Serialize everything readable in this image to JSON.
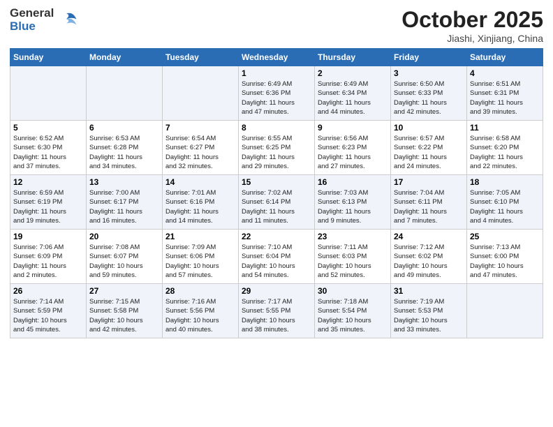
{
  "header": {
    "logo_general": "General",
    "logo_blue": "Blue",
    "month_title": "October 2025",
    "location": "Jiashi, Xinjiang, China"
  },
  "weekdays": [
    "Sunday",
    "Monday",
    "Tuesday",
    "Wednesday",
    "Thursday",
    "Friday",
    "Saturday"
  ],
  "rows": [
    [
      {
        "day": "",
        "info": ""
      },
      {
        "day": "",
        "info": ""
      },
      {
        "day": "",
        "info": ""
      },
      {
        "day": "1",
        "info": "Sunrise: 6:49 AM\nSunset: 6:36 PM\nDaylight: 11 hours\nand 47 minutes."
      },
      {
        "day": "2",
        "info": "Sunrise: 6:49 AM\nSunset: 6:34 PM\nDaylight: 11 hours\nand 44 minutes."
      },
      {
        "day": "3",
        "info": "Sunrise: 6:50 AM\nSunset: 6:33 PM\nDaylight: 11 hours\nand 42 minutes."
      },
      {
        "day": "4",
        "info": "Sunrise: 6:51 AM\nSunset: 6:31 PM\nDaylight: 11 hours\nand 39 minutes."
      }
    ],
    [
      {
        "day": "5",
        "info": "Sunrise: 6:52 AM\nSunset: 6:30 PM\nDaylight: 11 hours\nand 37 minutes."
      },
      {
        "day": "6",
        "info": "Sunrise: 6:53 AM\nSunset: 6:28 PM\nDaylight: 11 hours\nand 34 minutes."
      },
      {
        "day": "7",
        "info": "Sunrise: 6:54 AM\nSunset: 6:27 PM\nDaylight: 11 hours\nand 32 minutes."
      },
      {
        "day": "8",
        "info": "Sunrise: 6:55 AM\nSunset: 6:25 PM\nDaylight: 11 hours\nand 29 minutes."
      },
      {
        "day": "9",
        "info": "Sunrise: 6:56 AM\nSunset: 6:23 PM\nDaylight: 11 hours\nand 27 minutes."
      },
      {
        "day": "10",
        "info": "Sunrise: 6:57 AM\nSunset: 6:22 PM\nDaylight: 11 hours\nand 24 minutes."
      },
      {
        "day": "11",
        "info": "Sunrise: 6:58 AM\nSunset: 6:20 PM\nDaylight: 11 hours\nand 22 minutes."
      }
    ],
    [
      {
        "day": "12",
        "info": "Sunrise: 6:59 AM\nSunset: 6:19 PM\nDaylight: 11 hours\nand 19 minutes."
      },
      {
        "day": "13",
        "info": "Sunrise: 7:00 AM\nSunset: 6:17 PM\nDaylight: 11 hours\nand 16 minutes."
      },
      {
        "day": "14",
        "info": "Sunrise: 7:01 AM\nSunset: 6:16 PM\nDaylight: 11 hours\nand 14 minutes."
      },
      {
        "day": "15",
        "info": "Sunrise: 7:02 AM\nSunset: 6:14 PM\nDaylight: 11 hours\nand 11 minutes."
      },
      {
        "day": "16",
        "info": "Sunrise: 7:03 AM\nSunset: 6:13 PM\nDaylight: 11 hours\nand 9 minutes."
      },
      {
        "day": "17",
        "info": "Sunrise: 7:04 AM\nSunset: 6:11 PM\nDaylight: 11 hours\nand 7 minutes."
      },
      {
        "day": "18",
        "info": "Sunrise: 7:05 AM\nSunset: 6:10 PM\nDaylight: 11 hours\nand 4 minutes."
      }
    ],
    [
      {
        "day": "19",
        "info": "Sunrise: 7:06 AM\nSunset: 6:09 PM\nDaylight: 11 hours\nand 2 minutes."
      },
      {
        "day": "20",
        "info": "Sunrise: 7:08 AM\nSunset: 6:07 PM\nDaylight: 10 hours\nand 59 minutes."
      },
      {
        "day": "21",
        "info": "Sunrise: 7:09 AM\nSunset: 6:06 PM\nDaylight: 10 hours\nand 57 minutes."
      },
      {
        "day": "22",
        "info": "Sunrise: 7:10 AM\nSunset: 6:04 PM\nDaylight: 10 hours\nand 54 minutes."
      },
      {
        "day": "23",
        "info": "Sunrise: 7:11 AM\nSunset: 6:03 PM\nDaylight: 10 hours\nand 52 minutes."
      },
      {
        "day": "24",
        "info": "Sunrise: 7:12 AM\nSunset: 6:02 PM\nDaylight: 10 hours\nand 49 minutes."
      },
      {
        "day": "25",
        "info": "Sunrise: 7:13 AM\nSunset: 6:00 PM\nDaylight: 10 hours\nand 47 minutes."
      }
    ],
    [
      {
        "day": "26",
        "info": "Sunrise: 7:14 AM\nSunset: 5:59 PM\nDaylight: 10 hours\nand 45 minutes."
      },
      {
        "day": "27",
        "info": "Sunrise: 7:15 AM\nSunset: 5:58 PM\nDaylight: 10 hours\nand 42 minutes."
      },
      {
        "day": "28",
        "info": "Sunrise: 7:16 AM\nSunset: 5:56 PM\nDaylight: 10 hours\nand 40 minutes."
      },
      {
        "day": "29",
        "info": "Sunrise: 7:17 AM\nSunset: 5:55 PM\nDaylight: 10 hours\nand 38 minutes."
      },
      {
        "day": "30",
        "info": "Sunrise: 7:18 AM\nSunset: 5:54 PM\nDaylight: 10 hours\nand 35 minutes."
      },
      {
        "day": "31",
        "info": "Sunrise: 7:19 AM\nSunset: 5:53 PM\nDaylight: 10 hours\nand 33 minutes."
      },
      {
        "day": "",
        "info": ""
      }
    ]
  ]
}
